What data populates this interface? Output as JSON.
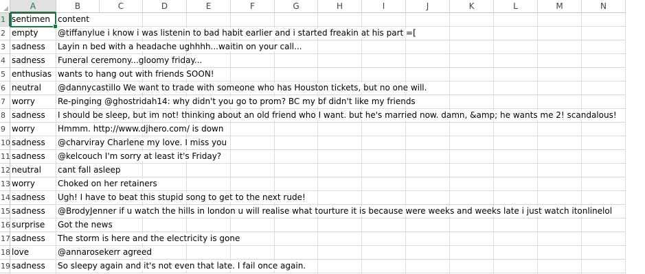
{
  "sheet": {
    "columns": [
      "A",
      "B",
      "C",
      "D",
      "E",
      "F",
      "G",
      "H",
      "I",
      "J",
      "K",
      "L",
      "M",
      "N"
    ],
    "active_column": "A",
    "active_row": "1",
    "rows": [
      {
        "num": "1",
        "a": "sentimen",
        "b": "content"
      },
      {
        "num": "2",
        "a": "empty",
        "b": "@tiffanylue i know  i was listenin to bad habit earlier and i started freakin at his part =["
      },
      {
        "num": "3",
        "a": "sadness",
        "b": "Layin n bed with a headache  ughhhh...waitin on your call..."
      },
      {
        "num": "4",
        "a": "sadness",
        "b": "Funeral ceremony...gloomy friday..."
      },
      {
        "num": "5",
        "a": "enthusias",
        "b": "wants to hang out with friends SOON!"
      },
      {
        "num": "6",
        "a": "neutral",
        "b": "@dannycastillo We want to trade with someone who has Houston tickets, but no one will."
      },
      {
        "num": "7",
        "a": "worry",
        "b": "Re-pinging @ghostridah14: why didn't you go to prom? BC my bf didn't like my friends"
      },
      {
        "num": "8",
        "a": "sadness",
        "b": "I should be sleep, but im not! thinking about an old friend who I want. but he's married now. damn, &amp; he wants me 2! scandalous!"
      },
      {
        "num": "9",
        "a": "worry",
        "b": "Hmmm. http://www.djhero.com/ is down"
      },
      {
        "num": "10",
        "a": "sadness",
        "b": "@charviray Charlene my love. I miss you"
      },
      {
        "num": "11",
        "a": "sadness",
        "b": "@kelcouch I'm sorry  at least it's Friday?"
      },
      {
        "num": "12",
        "a": "neutral",
        "b": "cant fall asleep"
      },
      {
        "num": "13",
        "a": "worry",
        "b": "Choked on her retainers"
      },
      {
        "num": "14",
        "a": "sadness",
        "b": "Ugh! I have to beat this stupid song to get to the next  rude!"
      },
      {
        "num": "15",
        "a": "sadness",
        "b": "@BrodyJenner if u watch the hills in london u will realise what tourture it is because were weeks and weeks late  i just watch itonlinelol"
      },
      {
        "num": "16",
        "a": "surprise",
        "b": "Got the news"
      },
      {
        "num": "17",
        "a": "sadness",
        "b": "The storm is here and the electricity is gone"
      },
      {
        "num": "18",
        "a": "love",
        "b": "@annarosekerr agreed"
      },
      {
        "num": "19",
        "a": "sadness",
        "b": "So sleepy again and it's not even that late. I fail once again."
      }
    ]
  },
  "colors": {
    "accent": "#217346",
    "grid": "#d9d9d9",
    "header_bg": "#ffffff",
    "header_active_bg": "#e1e1e1"
  }
}
